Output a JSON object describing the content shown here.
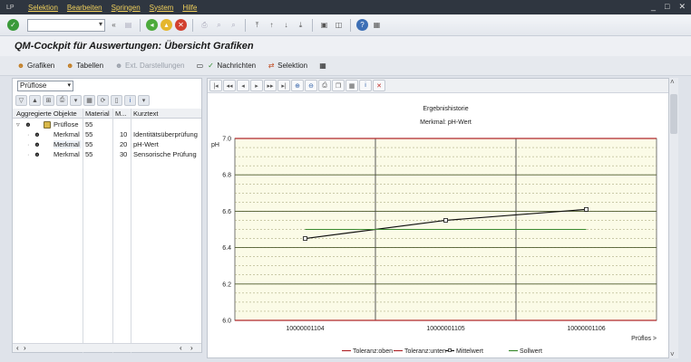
{
  "menu": {
    "items": [
      "Selektion",
      "Bearbeiten",
      "Springen",
      "System",
      "Hilfe"
    ],
    "window_controls": [
      "_",
      "□",
      "✕"
    ]
  },
  "title": "QM-Cockpit für Auswertungen: Übersicht Grafiken",
  "app_toolbar": {
    "grafiken": "Grafiken",
    "tabellen": "Tabellen",
    "ext_darstellungen": "Ext. Darstellungen",
    "nachrichten": "Nachrichten",
    "selektion": "Selektion"
  },
  "left_panel": {
    "select_value": "Prüflose",
    "columns": {
      "agg": "Aggregierte Objekte",
      "material": "Material",
      "m": "M...",
      "kurztext": "Kurztext"
    },
    "rows": [
      {
        "label": "Prüflose",
        "material": "55",
        "m": "",
        "kurztext": "",
        "checked": false
      },
      {
        "label": "Merkmal",
        "material": "55",
        "m": "10",
        "kurztext": "Identitätsüberprüfung",
        "checked": false
      },
      {
        "label": "Merkmal",
        "material": "55",
        "m": "20",
        "kurztext": "pH-Wert",
        "checked": true
      },
      {
        "label": "Merkmal",
        "material": "55",
        "m": "30",
        "kurztext": "Sensorische Prüfung",
        "checked": false
      }
    ]
  },
  "colors": {
    "tol_upper": "#b0282b",
    "tol_lower": "#b0282b",
    "mean": "#111111",
    "target": "#3a8a2e",
    "plot_bg": "#fbfbe7",
    "grid": "#4d5a2c"
  },
  "chart_data": {
    "type": "line",
    "title": "Ergebnishistorie",
    "subtitle": "Merkmal: pH-Wert",
    "ylabel": "pH",
    "xlabel": "Prüflos >",
    "categories": [
      "10000001104",
      "10000001105",
      "10000001106"
    ],
    "ylim": [
      6.0,
      7.0
    ],
    "yticks": [
      6.0,
      6.2,
      6.4,
      6.6,
      6.8,
      7.0
    ],
    "series": [
      {
        "name": "Toleranz:oben",
        "values": [
          7.0,
          7.0,
          7.0
        ]
      },
      {
        "name": "Toleranz:unten",
        "values": [
          6.0,
          6.0,
          6.0
        ]
      },
      {
        "name": "Mittelwert",
        "values": [
          6.45,
          6.55,
          6.61
        ]
      },
      {
        "name": "Sollwert",
        "values": [
          6.5,
          6.5,
          6.5
        ]
      }
    ],
    "grid": true,
    "legend": "bottom"
  }
}
